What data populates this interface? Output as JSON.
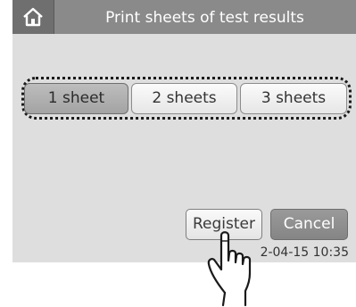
{
  "header": {
    "title": "Print sheets of test results",
    "home_icon": "home-icon"
  },
  "options": [
    {
      "label": "1 sheet",
      "selected": true
    },
    {
      "label": "2 sheets",
      "selected": false
    },
    {
      "label": "3 sheets",
      "selected": false
    }
  ],
  "actions": {
    "register_label": "Register",
    "cancel_label": "Cancel"
  },
  "status": {
    "datetime": "2-04-15 10:35"
  },
  "colors": {
    "screen_bg": "#dedede",
    "title_bar": "#8a8a8a",
    "selected_option": "#b0b0b0",
    "cancel_button": "#8f8f8f"
  },
  "overlay": {
    "pointer_icon": "tap-hand-icon"
  }
}
